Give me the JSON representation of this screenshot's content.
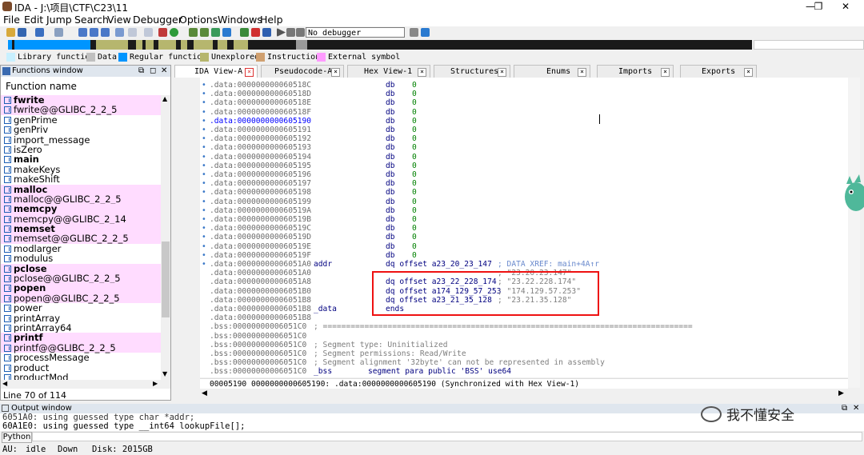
{
  "window": {
    "title": "IDA - J:\\项目\\CTF\\C23\\11",
    "min": "—",
    "max": "❐",
    "close": "✕"
  },
  "menu": [
    "File",
    "Edit",
    "Jump",
    "Search",
    "View",
    "Debugger",
    "Options",
    "Windows",
    "Help"
  ],
  "toolbar": {
    "debugger_select": "No debugger"
  },
  "legend": [
    {
      "label": "Library function",
      "color": "#c8f0ff"
    },
    {
      "label": "Data",
      "color": "#c0c0c0"
    },
    {
      "label": "Regular function",
      "color": "#0095ff"
    },
    {
      "label": "Unexplored",
      "color": "#b6b66e"
    },
    {
      "label": "Instruction",
      "color": "#d0a070"
    },
    {
      "label": "External symbol",
      "color": "#ff9bff"
    }
  ],
  "functions": {
    "title": "Functions window",
    "column": "Function name",
    "items": [
      {
        "name": "fwrite",
        "lib": true,
        "bold": true
      },
      {
        "name": "fwrite@@GLIBC_2_2_5",
        "lib": true,
        "bold": false
      },
      {
        "name": "genPrime",
        "lib": false,
        "bold": false
      },
      {
        "name": "genPriv",
        "lib": false,
        "bold": false
      },
      {
        "name": "import_message",
        "lib": false,
        "bold": false
      },
      {
        "name": "isZero",
        "lib": false,
        "bold": false
      },
      {
        "name": "main",
        "lib": false,
        "bold": true
      },
      {
        "name": "makeKeys",
        "lib": false,
        "bold": false
      },
      {
        "name": "makeShift",
        "lib": false,
        "bold": false
      },
      {
        "name": "malloc",
        "lib": true,
        "bold": true
      },
      {
        "name": "malloc@@GLIBC_2_2_5",
        "lib": true,
        "bold": false
      },
      {
        "name": "memcpy",
        "lib": true,
        "bold": true
      },
      {
        "name": "memcpy@@GLIBC_2_14",
        "lib": true,
        "bold": false
      },
      {
        "name": "memset",
        "lib": true,
        "bold": true
      },
      {
        "name": "memset@@GLIBC_2_2_5",
        "lib": true,
        "bold": false
      },
      {
        "name": "modlarger",
        "lib": false,
        "bold": false
      },
      {
        "name": "modulus",
        "lib": false,
        "bold": false
      },
      {
        "name": "pclose",
        "lib": true,
        "bold": true
      },
      {
        "name": "pclose@@GLIBC_2_2_5",
        "lib": true,
        "bold": false
      },
      {
        "name": "popen",
        "lib": true,
        "bold": true
      },
      {
        "name": "popen@@GLIBC_2_2_5",
        "lib": true,
        "bold": false
      },
      {
        "name": "power",
        "lib": false,
        "bold": false
      },
      {
        "name": "printArray",
        "lib": false,
        "bold": false
      },
      {
        "name": "printArray64",
        "lib": false,
        "bold": false
      },
      {
        "name": "printf",
        "lib": true,
        "bold": true
      },
      {
        "name": "printf@@GLIBC_2_2_5",
        "lib": true,
        "bold": false
      },
      {
        "name": "processMessage",
        "lib": false,
        "bold": false
      },
      {
        "name": "product",
        "lib": false,
        "bold": false
      },
      {
        "name": "productMod",
        "lib": false,
        "bold": false
      }
    ],
    "status": "Line 70 of 114"
  },
  "tabs": [
    {
      "label": "IDA View-A",
      "active": true
    },
    {
      "label": "Pseudocode-A",
      "active": false
    },
    {
      "label": "Hex View-1",
      "active": false
    },
    {
      "label": "Structures",
      "active": false
    },
    {
      "label": "Enums",
      "active": false
    },
    {
      "label": "Imports",
      "active": false
    },
    {
      "label": "Exports",
      "active": false
    }
  ],
  "disasm": [
    {
      "dot": true,
      "addr": ".data:000000000060518C",
      "label": "",
      "mn": "db",
      "op": "0"
    },
    {
      "dot": true,
      "addr": ".data:000000000060518D",
      "label": "",
      "mn": "db",
      "op": "0"
    },
    {
      "dot": true,
      "addr": ".data:000000000060518E",
      "label": "",
      "mn": "db",
      "op": "0"
    },
    {
      "dot": true,
      "addr": ".data:000000000060518F",
      "label": "",
      "mn": "db",
      "op": "0"
    },
    {
      "dot": true,
      "addr": ".data:0000000000605190",
      "label": "",
      "mn": "db",
      "op": "0",
      "hl": true
    },
    {
      "dot": true,
      "addr": ".data:0000000000605191",
      "label": "",
      "mn": "db",
      "op": "0"
    },
    {
      "dot": true,
      "addr": ".data:0000000000605192",
      "label": "",
      "mn": "db",
      "op": "0"
    },
    {
      "dot": true,
      "addr": ".data:0000000000605193",
      "label": "",
      "mn": "db",
      "op": "0"
    },
    {
      "dot": true,
      "addr": ".data:0000000000605194",
      "label": "",
      "mn": "db",
      "op": "0"
    },
    {
      "dot": true,
      "addr": ".data:0000000000605195",
      "label": "",
      "mn": "db",
      "op": "0"
    },
    {
      "dot": true,
      "addr": ".data:0000000000605196",
      "label": "",
      "mn": "db",
      "op": "0"
    },
    {
      "dot": true,
      "addr": ".data:0000000000605197",
      "label": "",
      "mn": "db",
      "op": "0"
    },
    {
      "dot": true,
      "addr": ".data:0000000000605198",
      "label": "",
      "mn": "db",
      "op": "0"
    },
    {
      "dot": true,
      "addr": ".data:0000000000605199",
      "label": "",
      "mn": "db",
      "op": "0"
    },
    {
      "dot": true,
      "addr": ".data:000000000060519A",
      "label": "",
      "mn": "db",
      "op": "0"
    },
    {
      "dot": true,
      "addr": ".data:000000000060519B",
      "label": "",
      "mn": "db",
      "op": "0"
    },
    {
      "dot": true,
      "addr": ".data:000000000060519C",
      "label": "",
      "mn": "db",
      "op": "0"
    },
    {
      "dot": true,
      "addr": ".data:000000000060519D",
      "label": "",
      "mn": "db",
      "op": "0"
    },
    {
      "dot": true,
      "addr": ".data:000000000060519E",
      "label": "",
      "mn": "db",
      "op": "0"
    },
    {
      "dot": true,
      "addr": ".data:000000000060519F",
      "label": "",
      "mn": "db",
      "op": "0"
    },
    {
      "dot": true,
      "addr": ".data:00000000006051A0",
      "label": "addr",
      "mn": "dq offset a23_20_23_147",
      "op": "",
      "cm": "; DATA XREF: main+4A↑r",
      "cmblue": true
    },
    {
      "dot": false,
      "addr": ".data:00000000006051A0",
      "label": "",
      "mn": "",
      "op": "",
      "cm": "; \"23.20.23.147\""
    },
    {
      "dot": false,
      "addr": ".data:00000000006051A8",
      "label": "",
      "mn": "dq offset a23_22_228_174",
      "op": "",
      "cm": "; \"23.22.228.174\""
    },
    {
      "dot": false,
      "addr": ".data:00000000006051B0",
      "label": "",
      "mn": "dq offset a174_129_57_253",
      "op": "",
      "cm": "; \"174.129.57.253\""
    },
    {
      "dot": false,
      "addr": ".data:00000000006051B8",
      "label": "",
      "mn": "dq offset a23_21_35_128",
      "op": "",
      "cm": "; \"23.21.35.128\""
    },
    {
      "dot": false,
      "addr": ".data:00000000006051B8",
      "label": "_data",
      "mn": "ends",
      "op": ""
    },
    {
      "dot": false,
      "addr": ".data:00000000006051B8",
      "label": "",
      "mn": "",
      "op": ""
    },
    {
      "dot": false,
      "addr": ".bss:00000000006051C0",
      "label": "",
      "mn": "",
      "op": "",
      "cm": "; ================================================================================"
    },
    {
      "dot": false,
      "addr": ".bss:00000000006051C0",
      "label": "",
      "mn": "",
      "op": ""
    },
    {
      "dot": false,
      "addr": ".bss:00000000006051C0",
      "label": "",
      "mn": "",
      "op": "",
      "cm": "; Segment type: Uninitialized"
    },
    {
      "dot": false,
      "addr": ".bss:00000000006051C0",
      "label": "",
      "mn": "",
      "op": "",
      "cm": "; Segment permissions: Read/Write"
    },
    {
      "dot": false,
      "addr": ".bss:00000000006051C0",
      "label": "",
      "mn": "",
      "op": "",
      "cm": "; Segment alignment '32byte' can not be represented in assembly"
    },
    {
      "dot": false,
      "addr": ".bss:00000000006051C0",
      "label": "_bss",
      "mn": "segment para public 'BSS' use64",
      "op": "",
      "seg": true
    }
  ],
  "sync": "00005190 0000000000605190: .data:0000000000605190 (Synchronized with Hex View-1)",
  "output": {
    "title": "Output window",
    "lines": [
      "6051A0: using guessed type char *addr;",
      "60A1E0: using guessed type __int64 lookupFile[];"
    ],
    "python": "Python"
  },
  "status": {
    "au": "AU:",
    "state": "idle",
    "dir": "Down",
    "disk": "Disk: 2015GB"
  },
  "watermark": "我不懂安全"
}
